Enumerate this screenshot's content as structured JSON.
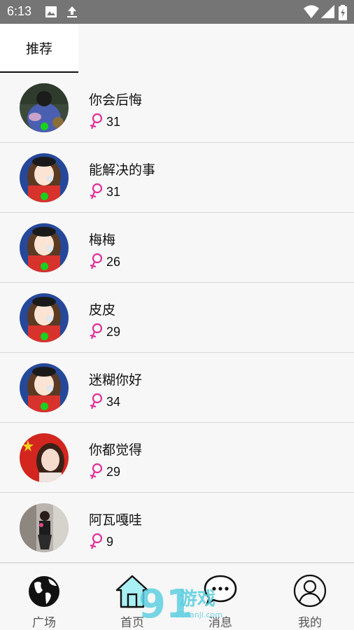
{
  "status_bar": {
    "time": "6:13",
    "icons": [
      "image-icon",
      "upload-icon",
      "wifi-icon",
      "signal-icon",
      "battery-icon"
    ]
  },
  "tabs": [
    {
      "label": "推荐",
      "active": true
    }
  ],
  "users": [
    {
      "name": "你会后悔",
      "age": "31",
      "gender": "female-icon",
      "online": true
    },
    {
      "name": "能解决的事",
      "age": "31",
      "gender": "female-icon",
      "online": true
    },
    {
      "name": "梅梅",
      "age": "26",
      "gender": "female-icon",
      "online": true
    },
    {
      "name": "皮皮",
      "age": "29",
      "gender": "female-icon",
      "online": true
    },
    {
      "name": "迷糊你好",
      "age": "34",
      "gender": "female-icon",
      "online": true
    },
    {
      "name": "你都觉得",
      "age": "29",
      "gender": "female-icon",
      "online": false
    },
    {
      "name": "阿瓦嘎哇",
      "age": "9",
      "gender": "female-icon",
      "online": false
    }
  ],
  "bottom_nav": [
    {
      "label": "广场",
      "icon": "globe-icon"
    },
    {
      "label": "首页",
      "icon": "home-icon"
    },
    {
      "label": "消息",
      "icon": "chat-bubble-icon"
    },
    {
      "label": "我的",
      "icon": "profile-icon"
    }
  ],
  "colors": {
    "female_pink": "#e0319a",
    "online_green": "#18d21d",
    "home_icon_fill": "#a8f0f4"
  },
  "watermark": {
    "text": "91游戏",
    "subtext": "91danji.com"
  }
}
